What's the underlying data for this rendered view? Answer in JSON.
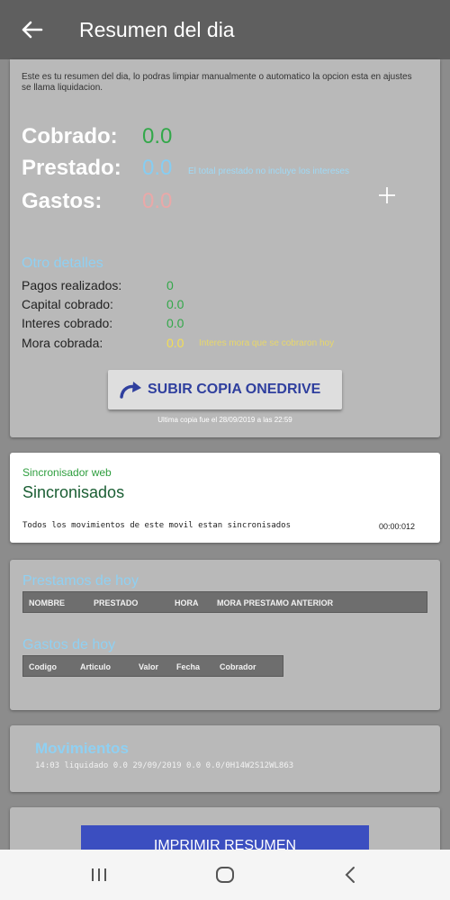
{
  "appbar": {
    "title": "Resumen del dia",
    "back_icon": "arrow-left-icon"
  },
  "summary": {
    "intro": "Este es tu resumen del dia, lo podras limpiar manualmente o automatico la opcion esta en ajustes se llama liquidacion.",
    "cobrado_label": "Cobrado:",
    "cobrado_value": "0.0",
    "prestado_label": "Prestado:",
    "prestado_value": "0.0",
    "prestado_note": "El total prestado no incluye los intereses",
    "gastos_label": "Gastos:",
    "gastos_value": "0.0",
    "add_icon": "plus-icon"
  },
  "details": {
    "title": "Otro detalles",
    "pagos_label": "Pagos realizados:",
    "pagos_value": "0",
    "capital_label": "Capital cobrado:",
    "capital_value": "0.0",
    "interes_label": "Interes cobrado:",
    "interes_value": "0.0",
    "mora_label": "Mora cobrada:",
    "mora_value": "0.0",
    "mora_note": "Interes mora que se cobraron hoy"
  },
  "onedrive": {
    "button_label": "SUBIR COPIA ONEDRIVE",
    "icon": "redo-arrow-icon",
    "last_copy": "Ultima copia fue el 28/09/2019  a las 22:59"
  },
  "sync": {
    "label": "Sincronisador web",
    "status": "Sincronisados",
    "message": "Todos los movimientos de este movil estan sincronisados",
    "time": "00:00:012"
  },
  "prestamos": {
    "title": "Prestamos de hoy",
    "columns": [
      "NOMBRE",
      "PRESTADO",
      "HORA",
      "MORA PRESTAMO ANTERIOR"
    ]
  },
  "gastos": {
    "title": "Gastos de hoy",
    "columns": [
      "Codigo",
      "Articulo",
      "Valor",
      "Fecha",
      "Cobrador"
    ]
  },
  "movimientos": {
    "title": "Movimientos",
    "line": "14:03 liquidado 0.0 29/09/2019 0.0  0.0/0H14W2S12WL863"
  },
  "print": {
    "label": "IMPRIMIR RESUMEN"
  },
  "navbar": {
    "recents_icon": "recents-icon",
    "home_icon": "home-icon",
    "back_icon": "back-chevron-icon"
  },
  "colors": {
    "green": "#33a84a",
    "blue": "#86cdf2",
    "pink": "#eaa8a8",
    "yellow": "#f3de54",
    "button_blue": "#3b4ec0"
  }
}
